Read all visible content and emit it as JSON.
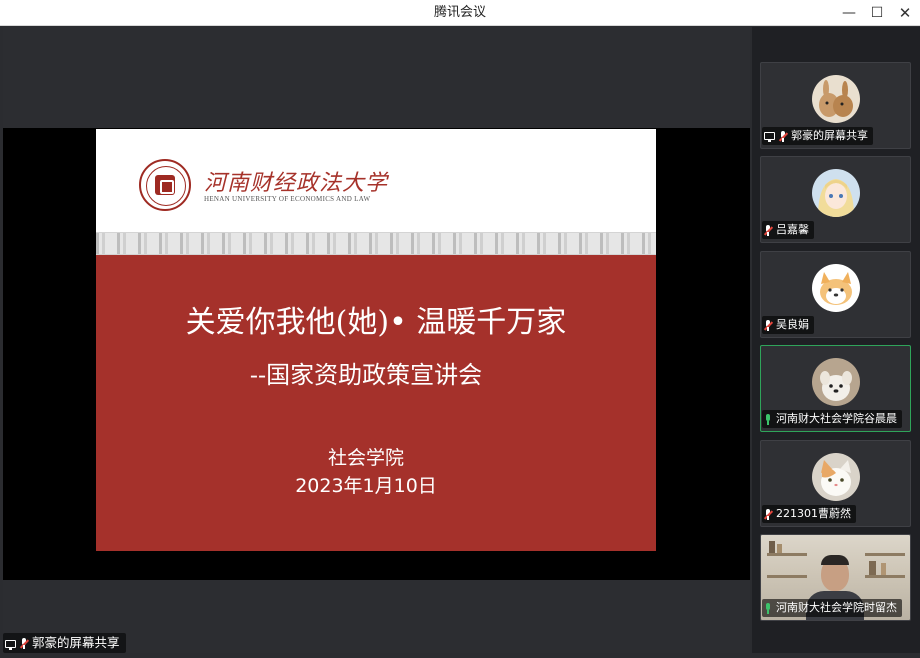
{
  "window": {
    "title": "腾讯会议",
    "minimize_glyph": "—",
    "maximize_glyph": "☐",
    "close_glyph": "✕"
  },
  "slide": {
    "university_cn": "河南财经政法大学",
    "university_en": "HENAN UNIVERSITY OF ECONOMICS AND LAW",
    "title": "关爱你我他(她)• 温暖千万家",
    "subtitle": "--国家资助政策宣讲会",
    "org": "社会学院",
    "date": "2023年1月10日"
  },
  "share_label": "郭豪的屏幕共享",
  "participants": [
    {
      "name": "郭豪的屏幕共享",
      "mic": "muted",
      "sharing": true,
      "avatar": "rabbit-avatar",
      "active": false
    },
    {
      "name": "吕嘉馨",
      "mic": "muted",
      "sharing": false,
      "avatar": "anime-girl-avatar",
      "active": false
    },
    {
      "name": "吴良娟",
      "mic": "muted",
      "sharing": false,
      "avatar": "dog-avatar",
      "active": false
    },
    {
      "name": "河南财大社会学院谷晨晨",
      "mic": "on",
      "sharing": false,
      "avatar": "white-dog-avatar",
      "active": true
    },
    {
      "name": "221301曹蔚然",
      "mic": "muted",
      "sharing": false,
      "avatar": "cat-avatar",
      "active": false
    },
    {
      "name": "河南财大社会学院时留杰",
      "mic": "on",
      "sharing": false,
      "avatar": "camera-video",
      "active": false
    }
  ],
  "colors": {
    "slide_red": "#a5312b",
    "active_border": "#2fa45a",
    "muted_red": "#e2453c"
  }
}
